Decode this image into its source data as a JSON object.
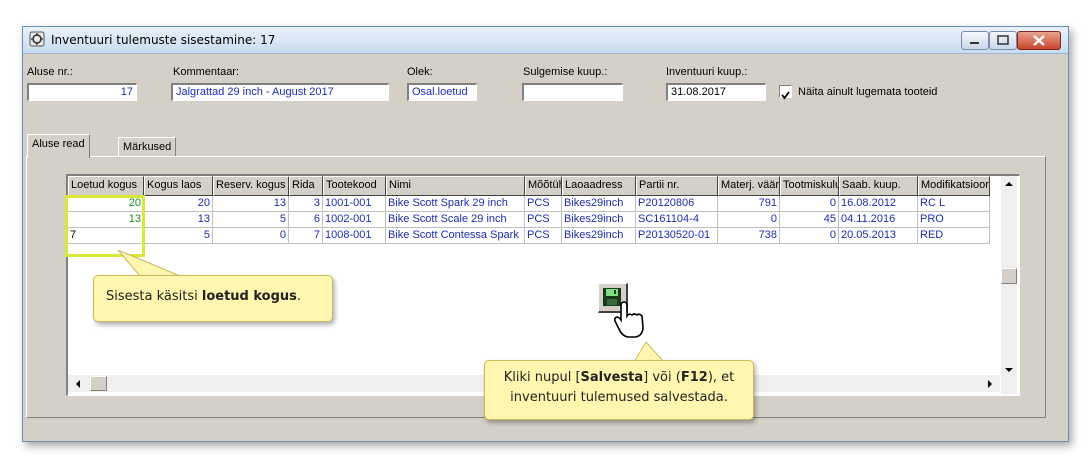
{
  "window": {
    "title": "Inventuuri tulemuste sisestamine: 17"
  },
  "form": {
    "aluse_nr": {
      "label": "Aluse nr.:",
      "value": "17"
    },
    "kommentaar": {
      "label": "Kommentaar:",
      "value": "Jalgrattad 29 inch - August 2017"
    },
    "olek": {
      "label": "Olek:",
      "value": "Osal.loetud"
    },
    "sulgemise_kuup": {
      "label": "Sulgemise kuup.:",
      "value": ""
    },
    "inventuuri_kuup": {
      "label": "Inventuuri kuup.:",
      "value": "31.08.2017"
    },
    "naita_lugemata": {
      "label": "Näita ainult lugemata tooteid",
      "checked": true
    }
  },
  "tabs": [
    {
      "label": "Aluse read",
      "active": true
    },
    {
      "label": "Märkused",
      "active": false
    }
  ],
  "table": {
    "columns": [
      "Loetud kogus",
      "Kogus laos",
      "Reserv. kogus",
      "Rida",
      "Tootekood",
      "Nimi",
      "Mõõtühik",
      "Laoaadress",
      "Partii nr.",
      "Materj. väärtus",
      "Tootmiskulu",
      "Saab. kuup.",
      "Modifikatsioon"
    ],
    "rows": [
      [
        "20",
        "20",
        "13",
        "3",
        "1001-001",
        "Bike Scott Spark 29 inch",
        "PCS",
        "Bikes29inch",
        "P20120806",
        "791",
        "0",
        "16.08.2012",
        "RC L"
      ],
      [
        "13",
        "13",
        "5",
        "6",
        "1002-001",
        "Bike Scott Scale 29 inch",
        "PCS",
        "Bikes29inch",
        "SC161104-4",
        "0",
        "45",
        "04.11.2016",
        "PRO"
      ],
      [
        "7",
        "5",
        "0",
        "7",
        "1008-001",
        "Bike Scott Contessa Spark",
        "PCS",
        "Bikes29inch",
        "P20130520-01",
        "738",
        "0",
        "20.05.2013",
        "RED"
      ]
    ]
  },
  "callouts": {
    "enter_count": {
      "prefix": "Sisesta käsitsi ",
      "bold": "loetud kogus",
      "suffix": "."
    },
    "save": {
      "line1_a": "Kliki nupul [",
      "line1_b": "Salvesta",
      "line1_c": "] või (",
      "line1_d": "F12",
      "line1_e": "), et",
      "line2": "inventuuri tulemused salvestada."
    }
  },
  "icons": {
    "save": "floppy-disk-icon",
    "cursor": "hand-pointer-icon"
  },
  "colors": {
    "value_blue": "#1c2eb0",
    "counted_green": "#1a8a1a",
    "callout_yellow": "#fff7b0",
    "highlight": "#d7e839"
  }
}
